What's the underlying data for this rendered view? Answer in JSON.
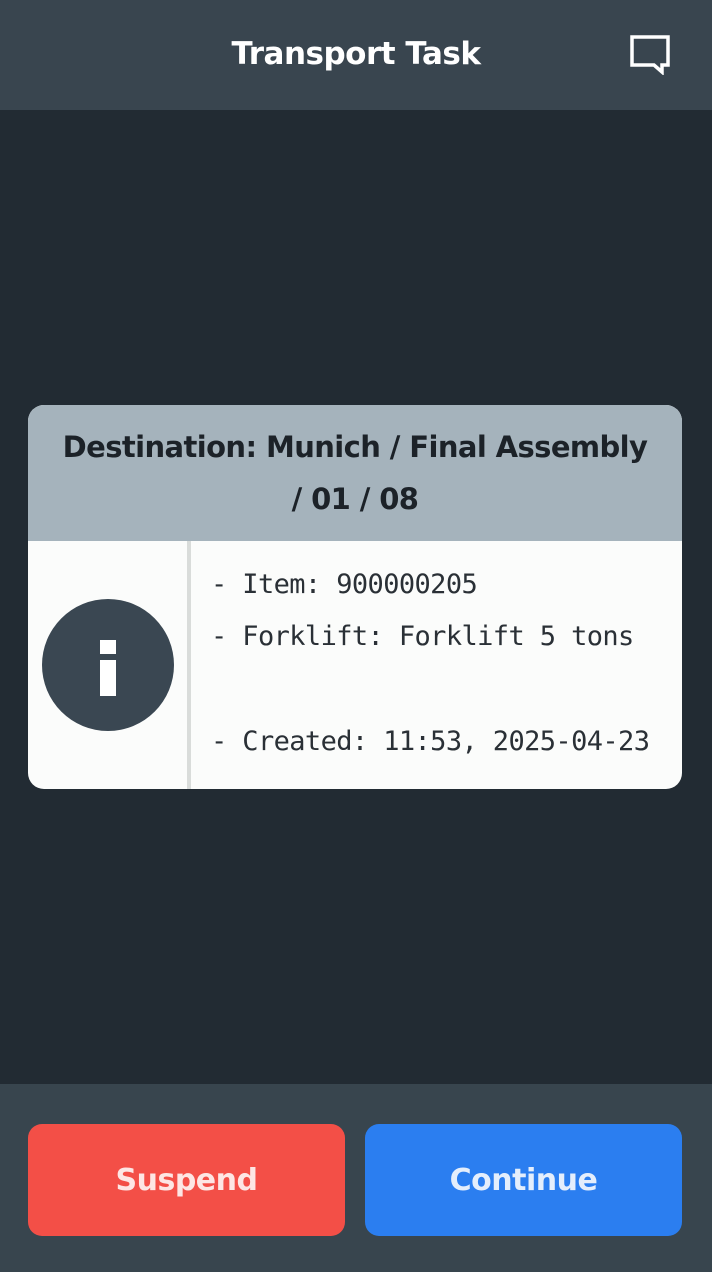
{
  "header": {
    "title": "Transport Task",
    "message_icon": "message-square-icon"
  },
  "card": {
    "destination": "Destination: Munich / Final Assembly / 01 / 08",
    "icon": "info-circle-icon",
    "details": {
      "item": "- Item: 900000205",
      "forklift": "- Forklift: Forklift 5 tons",
      "created": "- Created: 11:53, 2025-04-23"
    }
  },
  "actions": {
    "suspend_label": "Suspend",
    "continue_label": "Continue"
  },
  "colors": {
    "background": "#222b33",
    "header": "#39454f",
    "card_header": "#a5b3bc",
    "suspend": "#f34f47",
    "continue": "#2b7ef0",
    "info_icon": "#3a4752"
  }
}
